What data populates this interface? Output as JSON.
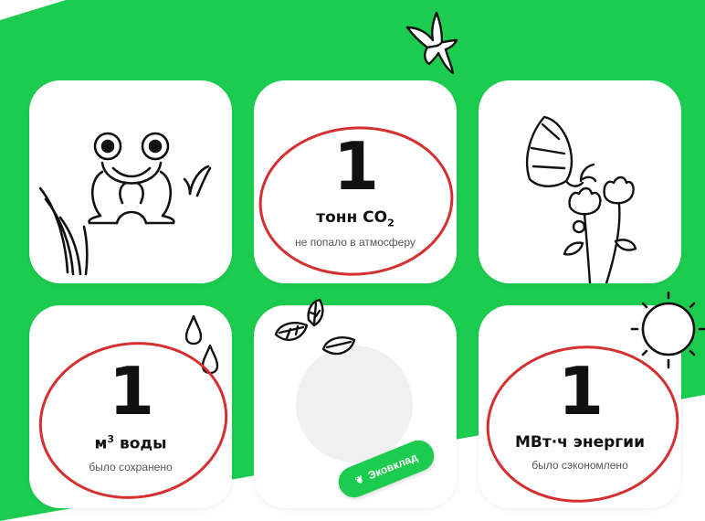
{
  "theme": {
    "accent": "#1ccc4f",
    "highlight": "#d62f2f"
  },
  "cards": {
    "co2": {
      "value": "1",
      "unit_prefix": "тонн CO",
      "unit_sub": "2",
      "note": "не попало в атмосферу"
    },
    "water": {
      "value": "1",
      "unit_prefix": "м",
      "unit_sup": "3",
      "unit_rest": " воды",
      "note": "было сохранено"
    },
    "energy": {
      "value": "1",
      "unit": "МВт·ч энергии",
      "note": "было сэкономлено"
    }
  },
  "badge": {
    "label": "Эковклад",
    "icon": "seedling-icon"
  },
  "icons": [
    "bird-icon",
    "frog-icon",
    "grass-icon",
    "butterfly-icon",
    "flower-icon",
    "raindrop-icon",
    "leaf-icon",
    "sun-icon"
  ]
}
